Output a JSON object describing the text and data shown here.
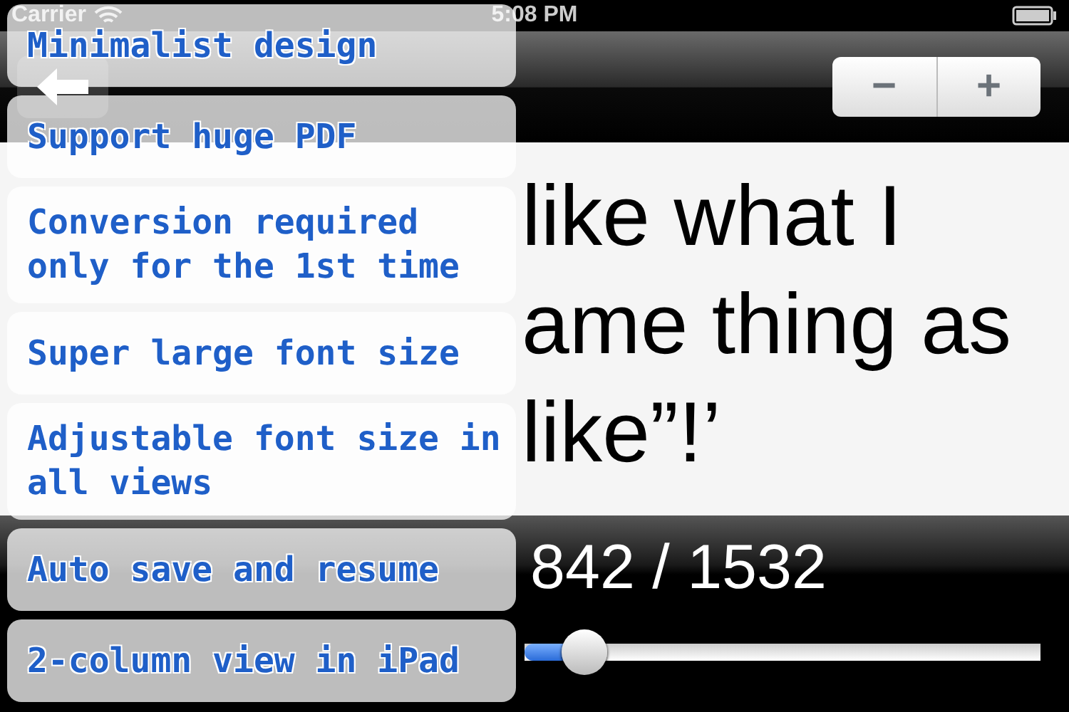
{
  "status_bar": {
    "carrier": "Carrier",
    "time": "5:08 PM"
  },
  "toolbar": {
    "zoom_buttons": [
      "−",
      "+"
    ]
  },
  "reader": {
    "lines": [
      "like what I",
      "ame thing as",
      "like”!’"
    ]
  },
  "page_indicator": "842 / 1532",
  "page_slider": {
    "level": 0.08
  },
  "features": [
    "Minimalist design",
    "Support huge PDF",
    "Conversion required only for the 1st time",
    "Super large font size",
    "Adjustable font size in all views",
    "Auto save and resume",
    "2-column view in iPad"
  ]
}
